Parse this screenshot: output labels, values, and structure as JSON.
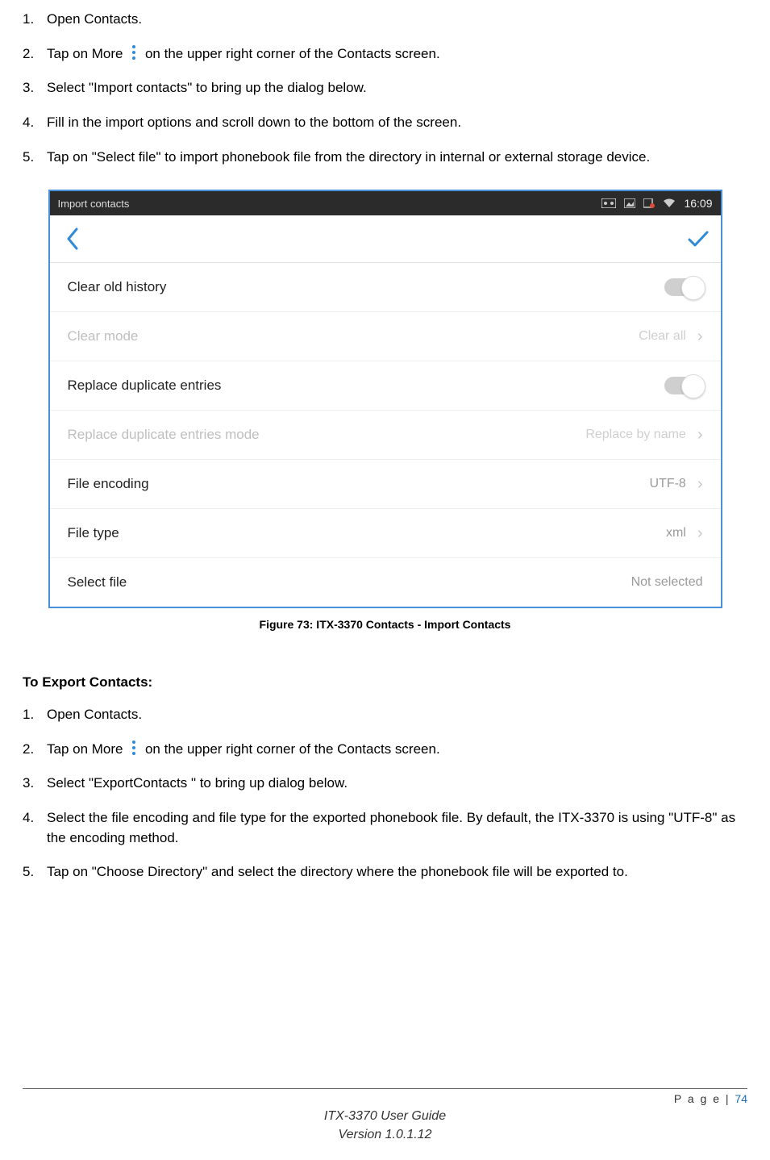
{
  "import_steps": {
    "s1_num": "1.",
    "s1": "Open Contacts.",
    "s2_num": "2.",
    "s2a": "Tap on More",
    "s2b": "on the upper right corner of the Contacts screen.",
    "s3_num": "3.",
    "s3": "Select \"Import contacts\" to bring up the dialog below.",
    "s4_num": "4.",
    "s4": "Fill in the import options and scroll down to the bottom of the screen.",
    "s5_num": "5.",
    "s5": "Tap on \"Select file\" to import phonebook file from the directory in internal or external storage device."
  },
  "figure": {
    "caption": "Figure 73: ITX-3370 Contacts - Import Contacts",
    "statusbar": {
      "title": "Import contacts",
      "time": "16:09"
    },
    "rows": {
      "r1_label": "Clear old history",
      "r2_label": "Clear mode",
      "r2_value": "Clear all",
      "r3_label": "Replace duplicate entries",
      "r4_label": "Replace duplicate entries mode",
      "r4_value": "Replace by name",
      "r5_label": "File encoding",
      "r5_value": "UTF-8",
      "r6_label": "File type",
      "r6_value": "xml",
      "r7_label": "Select file",
      "r7_value": "Not selected"
    }
  },
  "export_title": "To Export Contacts:",
  "export_steps": {
    "s1_num": "1.",
    "s1": "Open Contacts.",
    "s2_num": "2.",
    "s2a": "Tap on More",
    "s2b": "on the upper right corner of the Contacts screen.",
    "s3_num": "3.",
    "s3": "Select \"ExportContacts \" to bring up dialog below.",
    "s4_num": "4.",
    "s4": "Select the file encoding and file type for the exported phonebook file. By default, the ITX-3370 is using \"UTF-8\" as the encoding method.",
    "s5_num": "5.",
    "s5": "Tap on \"Choose Directory\" and select the directory where the phonebook file will be exported to."
  },
  "footer": {
    "page_label": "P a g e | ",
    "page_num": "74",
    "line1": "ITX-3370 User Guide",
    "line2": "Version 1.0.1.12"
  },
  "glyphs": {
    "chevron": "›"
  }
}
